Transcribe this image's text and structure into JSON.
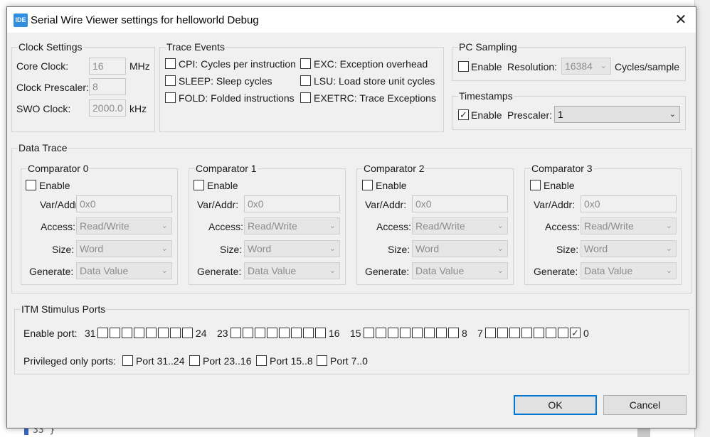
{
  "window": {
    "title": "Serial Wire Viewer settings for helloworld Debug",
    "icon_text": "IDE",
    "close_glyph": "✕"
  },
  "background": {
    "line_text": "33  }"
  },
  "clock": {
    "title": "Clock Settings",
    "core_label": "Core Clock:",
    "core_value": "16",
    "core_unit": "MHz",
    "prescaler_label": "Clock Prescaler:",
    "prescaler_value": "8",
    "swo_label": "SWO Clock:",
    "swo_value": "2000.0",
    "swo_unit": "kHz"
  },
  "trace_events": {
    "title": "Trace Events",
    "items": [
      {
        "label": "CPI: Cycles per instruction",
        "checked": false
      },
      {
        "label": "SLEEP: Sleep cycles",
        "checked": false
      },
      {
        "label": "FOLD: Folded instructions",
        "checked": false
      },
      {
        "label": "EXC: Exception overhead",
        "checked": false
      },
      {
        "label": "LSU: Load store unit cycles",
        "checked": false
      },
      {
        "label": "EXETRC: Trace Exceptions",
        "checked": false
      }
    ]
  },
  "pc_sampling": {
    "title": "PC Sampling",
    "enable_label": "Enable",
    "enabled": false,
    "resolution_label": "Resolution:",
    "resolution_value": "16384",
    "unit": "Cycles/sample"
  },
  "timestamps": {
    "title": "Timestamps",
    "enable_label": "Enable",
    "enabled": true,
    "prescaler_label": "Prescaler:",
    "prescaler_value": "1"
  },
  "data_trace": {
    "title": "Data Trace",
    "enable_label": "Enable",
    "var_label": "Var/Addr:",
    "access_label": "Access:",
    "size_label": "Size:",
    "generate_label": "Generate:",
    "comparators": [
      {
        "title": "Comparator 0",
        "var": "0x0",
        "access": "Read/Write",
        "size": "Word",
        "generate": "Data Value"
      },
      {
        "title": "Comparator 1",
        "var": "0x0",
        "access": "Read/Write",
        "size": "Word",
        "generate": "Data Value"
      },
      {
        "title": "Comparator 2",
        "var": "0x0",
        "access": "Read/Write",
        "size": "Word",
        "generate": "Data Value"
      },
      {
        "title": "Comparator 3",
        "var": "0x0",
        "access": "Read/Write",
        "size": "Word",
        "generate": "Data Value"
      }
    ]
  },
  "itm": {
    "title": "ITM Stimulus Ports",
    "enable_port_label": "Enable port:",
    "port_groups": [
      {
        "start": "31",
        "end": "24",
        "checked": [
          false,
          false,
          false,
          false,
          false,
          false,
          false,
          false
        ]
      },
      {
        "start": "23",
        "end": "16",
        "checked": [
          false,
          false,
          false,
          false,
          false,
          false,
          false,
          false
        ]
      },
      {
        "start": "15",
        "end": "8",
        "checked": [
          false,
          false,
          false,
          false,
          false,
          false,
          false,
          false
        ]
      },
      {
        "start": "7",
        "end": "0",
        "checked": [
          false,
          false,
          false,
          false,
          false,
          false,
          false,
          true
        ]
      }
    ],
    "privileged_label": "Privileged only ports:",
    "privileged": [
      {
        "label": "Port 31..24",
        "checked": false
      },
      {
        "label": "Port 23..16",
        "checked": false
      },
      {
        "label": "Port 15..8",
        "checked": false
      },
      {
        "label": "Port 7..0",
        "checked": false
      }
    ]
  },
  "buttons": {
    "ok": "OK",
    "cancel": "Cancel"
  }
}
